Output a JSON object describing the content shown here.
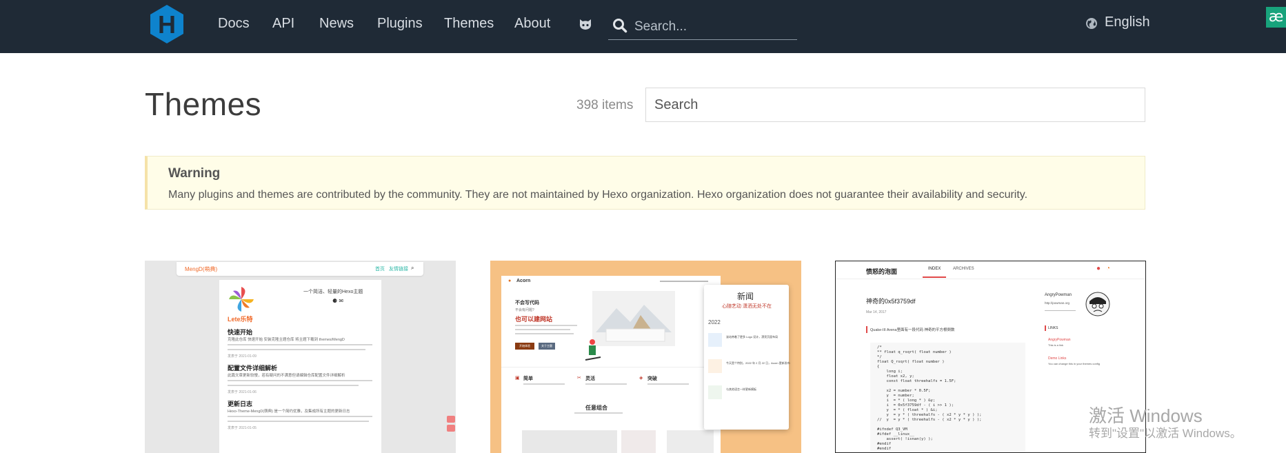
{
  "header": {
    "nav": [
      "Docs",
      "API",
      "News",
      "Plugins",
      "Themes",
      "About"
    ],
    "search_placeholder": "Search...",
    "language": "English",
    "ae_badge": "æ"
  },
  "main": {
    "title": "Themes",
    "count": "398 items",
    "search_placeholder": "Search"
  },
  "warning": {
    "title": "Warning",
    "text": "Many plugins and themes are contributed by the community. They are not maintained by Hexo organization. Hexo organization does not guarantee their availability and security."
  },
  "cards": {
    "c1": {
      "brand": "MengD(萌典)",
      "nav1": "首页",
      "nav2": "友情链接",
      "tagline": "一个简洁、轻量的Hexo主题",
      "logo_text": "Lete乐特",
      "post1_title": "快速开始",
      "post1_text": "克隆此仓库 快速开始 安装克隆主题仓库 将主题下载到 themes/MengD",
      "post1_date": "发表于 2021-01-09",
      "post2_title": "配置文件详细解析",
      "post2_text": "此篇文章更新较慢，若有疑问的不满意但请编辑仓库配置文件详细解析",
      "post2_date": "发表于 2021-01-06",
      "post3_title": "更新日志",
      "post3_text": "Hexo-Theme-MengD(萌典) 是一个简约优雅，及集成所有主题的更新日志",
      "post3_date": "发表于 2021-01-05"
    },
    "c2": {
      "brand": "Acorn",
      "hero_small": "不会写代码",
      "hero_sub": "不会有问题?",
      "hero_big": "也可以建网站",
      "btn1": "开始体验",
      "btn2": "关于主题",
      "news_title": "新闻",
      "news_sub": "心随艺动 潇洒无处不在",
      "news_year": "2022",
      "news1": "该站带着了更多 Logo 设计，漂亮页面布局",
      "news2": "今天是个特别，2022 年 2 月 22 日，Acorn 更新发布",
      "news3": "与其他语言一样更新模板",
      "feat1": "简单",
      "feat2": "灵活",
      "feat3": "突破",
      "section": "任意组合"
    },
    "c3": {
      "blog_title": "愤怒的泡面",
      "nav1": "INDEX",
      "nav2": "ARCHIVES",
      "post_title": "神奇的0x5f3759df",
      "date": "Mar 14, 2017",
      "quote": "Quake-III Arena里面有一段代码 神奇的平方根倒数",
      "author": "AngryPowman",
      "url": "http://powman.org",
      "links": "LINKS",
      "link1": "AngryPowman",
      "link1_desc": "This is a link",
      "link2": "Demo Links",
      "link2_desc": "You can change this in your themes config",
      "code": [
        "/*",
        "** float q_rsqrt( float number )",
        "*/",
        "float Q_rsqrt( float number )",
        "{",
        "    long i;",
        "    float x2, y;",
        "    const float threehalfs = 1.5F;",
        "",
        "    x2 = number * 0.5F;",
        "    y  = number;",
        "    i  = * ( long * ) &y;",
        "    i  = 0x5f3759df - ( i >> 1 );",
        "    y  = * ( float * ) &i;",
        "    y  = y * ( threehalfs - ( x2 * y * y ) );",
        "//  y  = y * ( threehalfs - ( x2 * y * y ) );",
        "",
        "#ifndef Q3_VM",
        "#ifdef __linux__",
        "    assert( !isnan(y) );",
        "#endif",
        "#endif"
      ]
    }
  },
  "watermark": {
    "line1": "激活 Windows",
    "line2": "转到\"设置\"以激活 Windows。"
  },
  "colors": {
    "header_bg": "#1f2a36",
    "logo": "#0e83cd",
    "warning_bg": "#fffde8",
    "card2_bg": "#f6c184"
  }
}
